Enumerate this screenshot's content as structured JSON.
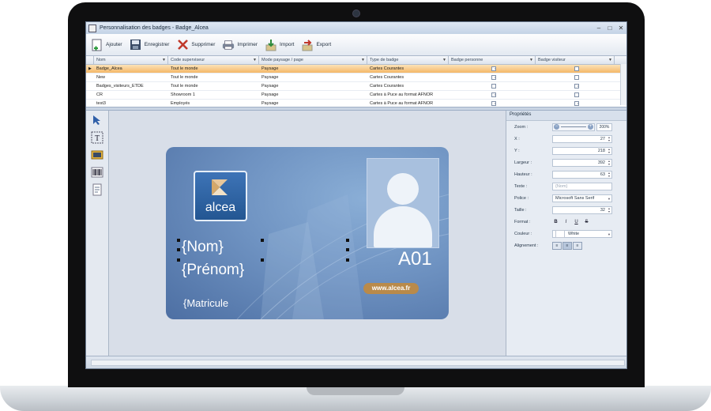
{
  "window": {
    "title": "Personnalisation des badges - Badge_Alcea",
    "controls": [
      "–",
      "□",
      "✕"
    ]
  },
  "toolbar": {
    "buttons": [
      {
        "label": "Ajouter",
        "icon": "add-document-icon"
      },
      {
        "label": "Enregistrer",
        "icon": "save-icon"
      },
      {
        "label": "Supprimer",
        "icon": "delete-icon"
      },
      {
        "label": "Imprimer",
        "icon": "printer-icon"
      },
      {
        "label": "Import",
        "icon": "import-icon"
      },
      {
        "label": "Export",
        "icon": "export-icon"
      }
    ]
  },
  "grid": {
    "columns": [
      "Nom",
      "Code superviseur",
      "Mode paysage / page",
      "Type de badge",
      "Badge personne",
      "Badge visiteur"
    ],
    "rows": [
      {
        "nom": "Badge_Alcea",
        "code": "Tout le monde",
        "mode": "Paysage",
        "type": "Cartes Courantes",
        "personne": true,
        "visiteur": false,
        "selected": true
      },
      {
        "nom": "New",
        "code": "Tout le monde",
        "mode": "Paysage",
        "type": "Cartes Courantes",
        "personne": true,
        "visiteur": false,
        "selected": false
      },
      {
        "nom": "Badges_visiteurs_ETDE",
        "code": "Tout le monde",
        "mode": "Paysage",
        "type": "Cartes Courantes",
        "personne": false,
        "visiteur": true,
        "selected": false
      },
      {
        "nom": "CR",
        "code": "Showroom 1",
        "mode": "Paysage",
        "type": "Cartes à Puce au format AFNOR",
        "personne": true,
        "visiteur": false,
        "selected": false
      },
      {
        "nom": "test3",
        "code": "Employés",
        "mode": "Paysage",
        "type": "Cartes à Puce au format AFNOR",
        "personne": true,
        "visiteur": true,
        "selected": false
      }
    ]
  },
  "tools": [
    "select-arrow-icon",
    "text-tool-icon",
    "image-tool-icon",
    "barcode-tool-icon",
    "document-tool-icon"
  ],
  "badge": {
    "logo_text": "alcea",
    "nom": "{Nom}",
    "prenom": "{Prénom}",
    "matricule": "{Matricule",
    "code": "A01",
    "url": "www.alcea.fr"
  },
  "properties": {
    "title": "Propriétés",
    "zoom_label": "Zoom :",
    "zoom_value": "200%",
    "fields": [
      {
        "label": "X :",
        "value": "27",
        "spin": true
      },
      {
        "label": "Y :",
        "value": "218",
        "spin": true
      },
      {
        "label": "Largeur :",
        "value": "392",
        "spin": true
      },
      {
        "label": "Hauteur :",
        "value": "63",
        "spin": true
      },
      {
        "label": "Texte :",
        "value": "{Nom}",
        "spin": false,
        "placeholder": true
      },
      {
        "label": "Police :",
        "value": "Microsoft Sans Serif",
        "spin": false,
        "dropdown": true
      },
      {
        "label": "Taille :",
        "value": "32",
        "spin": true
      }
    ],
    "format_label": "Format :",
    "format_buttons": [
      "B",
      "I",
      "U",
      "S"
    ],
    "couleur_label": "Couleur :",
    "couleur_value": "White",
    "alignement_label": "Alignement :"
  },
  "colors": {
    "selection": "#f5b867",
    "card": "#6f93c2",
    "url_badge": "#b98a4a"
  }
}
